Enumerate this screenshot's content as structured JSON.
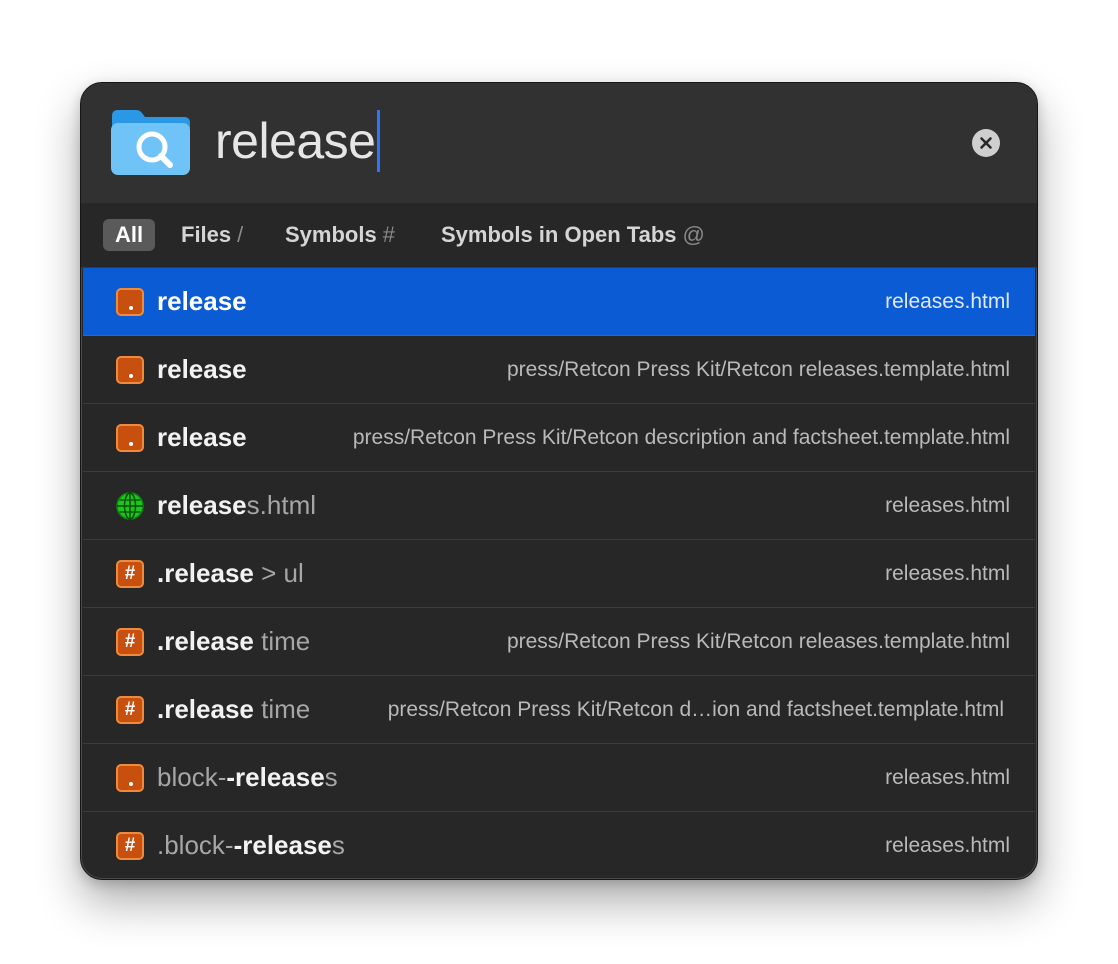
{
  "search": {
    "query": "release"
  },
  "tabs": [
    {
      "label": "All",
      "suffix": ""
    },
    {
      "label": "Files",
      "suffix": "/"
    },
    {
      "label": "Symbols",
      "suffix": "#"
    },
    {
      "label": "Symbols in Open Tabs",
      "suffix": "@"
    }
  ],
  "results": [
    {
      "icon": "element-dot-icon",
      "pre": "",
      "match": "release",
      "post": "",
      "path": "releases.html",
      "selected": true
    },
    {
      "icon": "element-dot-icon",
      "pre": "",
      "match": "release",
      "post": "",
      "path": "press/Retcon Press Kit/Retcon releases.template.html"
    },
    {
      "icon": "element-dot-icon",
      "pre": "",
      "match": "release",
      "post": "",
      "path": "press/Retcon Press Kit/Retcon description and factsheet.template.html"
    },
    {
      "icon": "globe-icon",
      "pre": "",
      "match": "release",
      "post": "s.html",
      "path": "releases.html"
    },
    {
      "icon": "hash-icon",
      "pre": "",
      "match": ".release",
      "post": " > ul",
      "path": "releases.html"
    },
    {
      "icon": "hash-icon",
      "pre": "",
      "match": ".release",
      "post": " time",
      "path": "press/Retcon Press Kit/Retcon releases.template.html"
    },
    {
      "icon": "hash-icon",
      "pre": "",
      "match": ".release",
      "post": " time",
      "path": "press/Retcon Press Kit/Retcon d…ion and factsheet.template.html"
    },
    {
      "icon": "element-dot-icon",
      "pre": "block-",
      "match": "-release",
      "post": "s",
      "path": "releases.html"
    },
    {
      "icon": "hash-icon",
      "pre": ".block-",
      "match": "-release",
      "post": "s",
      "path": "releases.html"
    }
  ],
  "colors": {
    "selection": "#0b5bd4",
    "accent_caret": "#2a76ff",
    "icon_orange": "#c7500e",
    "globe_green": "#1ec51e"
  }
}
